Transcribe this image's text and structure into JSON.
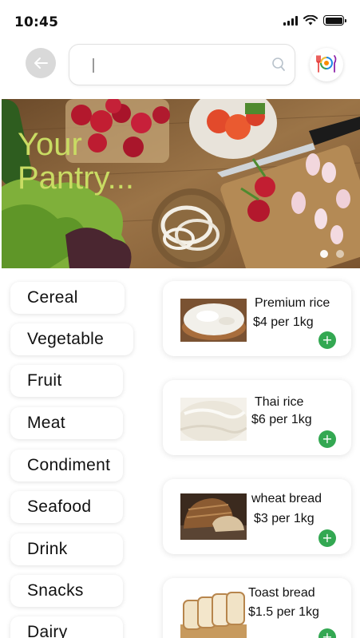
{
  "status_bar": {
    "time": "10:45",
    "icons": [
      "signal-icon",
      "wifi-icon",
      "battery-icon"
    ]
  },
  "header": {
    "back_icon": "arrow-left-icon",
    "search": {
      "value": "",
      "placeholder": "",
      "icon": "search-icon"
    },
    "logo_icon": "restaurant-logo-icon"
  },
  "banner": {
    "title_line1": "Your",
    "title_line2": "Pantry...",
    "slide_count": 2,
    "active_slide": 1
  },
  "categories": [
    "Cereal",
    "Vegetable",
    "Fruit",
    "Meat",
    "Condiment",
    "Seafood",
    "Drink",
    "Snacks",
    "Dairy"
  ],
  "products": [
    {
      "name": "Premium rice",
      "price": "$4 per 1kg",
      "image": "rice-bowl"
    },
    {
      "name": "Thai rice",
      "price": "$6 per 1kg",
      "image": "rice-pile"
    },
    {
      "name": "wheat bread",
      "price": "$3 per 1kg",
      "image": "wheat-bread"
    },
    {
      "name": "Toast bread",
      "price": "$1.5 per 1kg",
      "image": "toast-bread"
    }
  ],
  "add_label": "+",
  "colors": {
    "accent_green": "#33a852",
    "banner_text": "#c9dc63",
    "back_button_bg": "#d9d9d9"
  }
}
